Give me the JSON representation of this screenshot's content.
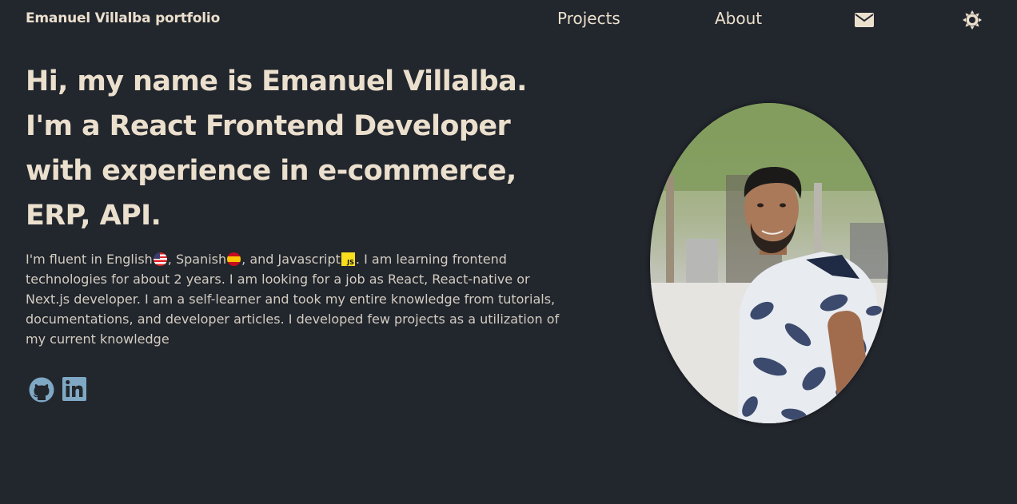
{
  "header": {
    "brand": "Emanuel Villalba portfolio",
    "nav": [
      {
        "label": "Projects"
      },
      {
        "label": "About"
      }
    ],
    "icons": {
      "mail": "mail-icon",
      "theme": "sun-icon"
    }
  },
  "hero": {
    "headline": "Hi, my name is Emanuel Villalba. I'm a React Frontend Developer with experience in e-commerce, ERP, API.",
    "intro": {
      "part1": "I'm fluent in English",
      "part2": ", Spanish",
      "part3": ", and Javascript",
      "js_badge": "JS",
      "part4": ". I am learning frontend technologies for about 2 years. I am looking for a job as React, React-native or Next.js developer. I am a self-learner and took my entire knowledge from tutorials, documentations, and developer articles. I developed few projects as a utilization of my current knowledge"
    },
    "social": [
      {
        "name": "github-icon"
      },
      {
        "name": "linkedin-icon"
      }
    ]
  },
  "colors": {
    "background": "#22262d",
    "text": "#ebdfcd",
    "icon": "#7fa8c4"
  }
}
